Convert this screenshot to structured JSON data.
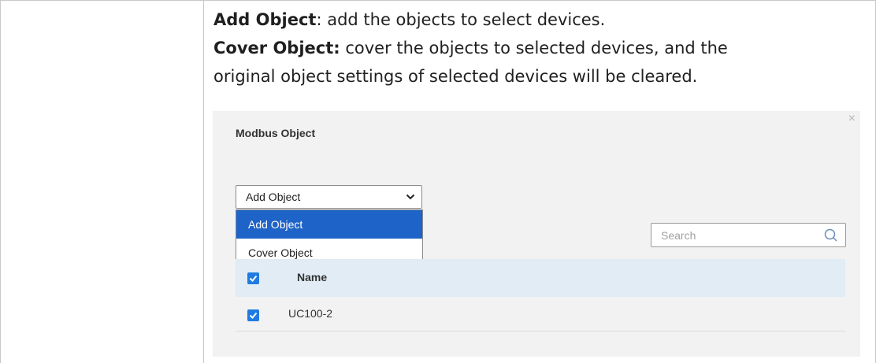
{
  "text": {
    "line1_bold": "Add Object",
    "line1_rest": ": add the objects to select devices.",
    "line2_bold": "Cover Object:",
    "line2_rest": " cover the objects to selected devices, and the",
    "line3": "original object settings of selected devices will be cleared."
  },
  "dialog": {
    "title": "Modbus Object",
    "close_glyph": "×",
    "select": {
      "value": "Add Object",
      "icon": "chevron-down-icon"
    },
    "dropdown_options": [
      {
        "label": "Add Object",
        "selected": true
      },
      {
        "label": "Cover Object",
        "selected": false
      }
    ],
    "search": {
      "placeholder": "Search",
      "icon": "search-icon"
    },
    "table": {
      "header": {
        "name": "Name",
        "checked": true
      },
      "rows": [
        {
          "name": "UC100-2",
          "checked": true
        }
      ]
    },
    "colors": {
      "accent": "#1e63c8",
      "checkbox": "#1e7be2",
      "header_bg": "#e1ecf4",
      "panel_bg": "#f2f2f2"
    }
  }
}
